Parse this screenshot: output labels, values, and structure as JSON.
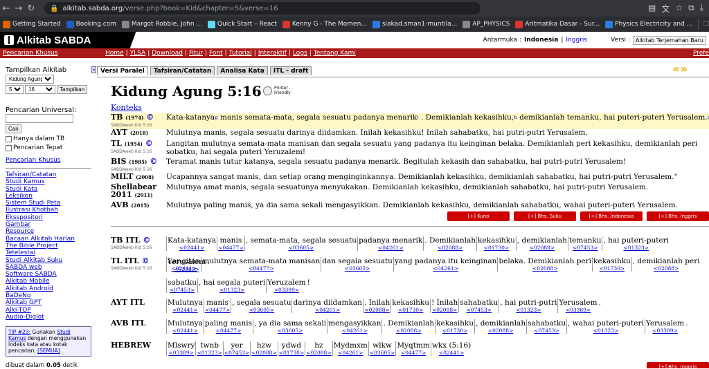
{
  "browser": {
    "url_host": "alkitab.sabda.org",
    "url_path": "/verse.php?book=Kid&chapter=5&verse=16"
  },
  "bookmarks": [
    {
      "label": "Getting Started",
      "color": "#e66000"
    },
    {
      "label": "Booking.com",
      "color": "#1e5fbf"
    },
    {
      "label": "Margot Robbie, John ...",
      "color": "#888"
    },
    {
      "label": "Quick Start – React",
      "color": "#61dafb"
    },
    {
      "label": "Kenny G - The Momen...",
      "color": "#d33"
    },
    {
      "label": "siakad.sman1-muntila...",
      "color": "#2c7be5"
    },
    {
      "label": "AP_PHYSICS",
      "color": "#888"
    },
    {
      "label": "Aritmatika Dasar - Sur...",
      "color": "#d33"
    },
    {
      "label": "Physics Electricity and ...",
      "color": "#2c7be5"
    }
  ],
  "other_bookmarks": "Other Boo",
  "site": {
    "logo": "Alkitab SABDA",
    "antarmuka_label": "Antarmuka :",
    "lang_current": "Indonesia",
    "lang_sep": "|",
    "lang_other": "Inggris",
    "versi_label": "Versi :",
    "versi_value": "Alkitab Terjemahan Baru"
  },
  "nav": {
    "left": "Pencarian Khusus",
    "links": [
      "Home",
      "YLSA",
      "Download",
      "Fitur",
      "Font",
      "Tutorial",
      "Interaktif",
      "Logs",
      "Tentang Kami"
    ],
    "right": "Prefe"
  },
  "sidebar": {
    "tampilkan": "Tampilkan Alkitab",
    "book": "Kidung Agung",
    "chapter": "5",
    "verse": "16",
    "tampilkan_btn": "Tampilkan",
    "pencarian_label": "Pencarian Universal:",
    "cari_btn": "Cari",
    "opt1": "Hanya dalam TB",
    "opt2": "Pencarian Tepat",
    "khusus": "Pencarian Khusus",
    "links": [
      "Tafsiran/Catatan",
      "Studi Kamus",
      "Studi Kata",
      "Leksikon",
      "Sistem Studi Peta",
      "Ilustrasi Khotbah",
      "Eksspositori",
      "Gambar",
      "Resource",
      "Bacaan Alkitab Harian",
      "The Bible Project",
      "Tetelestai",
      "Studi Alkitab Suku",
      "SABDA web",
      "Software SABDA",
      "Alkitab Mobile",
      "Alkitab Android",
      "BaDeNo",
      "Alkitab GPT",
      "Alki-TOP",
      "Audio-Diglot"
    ],
    "tip_prefix": "TIP #23:",
    "tip_text1": " Gunakan ",
    "tip_link": "Studi Kamus",
    "tip_text2": " dengan menggunakan indeks kata atau kotak pencarian. ",
    "tip_semua": "[SEMUA]",
    "footer_pre": "dibuat dalam ",
    "footer_val": "0.05",
    "footer_post": " detik"
  },
  "tabs": [
    "Versi Paralel",
    "Tafsiran/Catatan",
    "Analisa Kata",
    "ITL - draft"
  ],
  "arrows": "«»",
  "title": "Kidung Agung 5:16",
  "printer": [
    "Printer",
    "Friendly"
  ],
  "konteks": "Konteks",
  "verses": [
    {
      "v": "TB",
      "y": "(1974)",
      "copy": "©",
      "sub": "SABDAweb Kid 5:16",
      "t1": "Kata-katanya",
      "s1": "g",
      "t2": " manis semata-mata, segala sesuatu padanya menarik",
      "s2": "i",
      "t3": " . Demikianlah kekasihku,",
      "s3": "h",
      "t4": " demikianlah temanku, hai puteri-puteri Yerusalem.",
      "s4": "i"
    },
    {
      "v": "AYT",
      "y": "(2018)",
      "text": "Mulutnya manis, segala sesuatu darinya diidamkan. Inilah kekasihku! Inilah sahabatku, hai putri-putri Yerusalem."
    },
    {
      "v": "TL",
      "y": "(1954)",
      "copy": "©",
      "sub": "SABDAweb Kid 5:16",
      "text": "Langitan mulutnya semata-mata manisan dan segala sesuatu yang padanya itu keinginan belaka. Demikianlah peri kekasihku, demikianlah peri sobatku, hai segala puteri Yeruzalem!"
    },
    {
      "v": "BIS",
      "y": "(1985)",
      "copy": "©",
      "sub": "SABDAweb Kid 5:16",
      "text": "Teramat manis tutur katanya, segala sesuatu padanya menarik. Begitulah kekasih dan sahabatku, hai putri-putri Yerusalem!"
    },
    {
      "v": "MILT",
      "y": "(2008)",
      "text": "Ucapannya sangat manis, dan setiap orang menginginkannya. Demikianlah kekasihku, demikianlah sahabatku, hai putri-putri Yerusalem.\""
    },
    {
      "v": "Shellabear 2011",
      "y": "(2011)",
      "text": "Mulutnya amat manis, segala sesuatunya menyukakan. Demikianlah kekasihku, demikianlah sahabatku, hai putri-putri Yerusalem."
    },
    {
      "v": "AVB",
      "y": "(2015)",
      "text": "Mulutnya paling manis, ya dia sama sekali mengasyikkan. Demikianlah kekasihku, demikianlah sahabatku, wahai puteri-puteri Yerusalem."
    }
  ],
  "buttons": [
    "[+] Kuno",
    "[+] Bhs. Suku",
    "[+] Bhs. Indonesia",
    "[+] Bhs. Inggris"
  ],
  "itl": [
    {
      "label": "TB ITL",
      "copy": "©",
      "sub": "SABDAweb Kid 5:16",
      "words": [
        [
          "Kata-katanya",
          "<02441>"
        ],
        [
          "manis",
          "<04477>"
        ],
        [
          ", semata-mata, segala sesuatu",
          "<03605>"
        ],
        [
          "padanya menarik",
          "<04261>"
        ],
        [
          ". Demikianlah",
          "<02088>"
        ],
        [
          "kekasihku",
          "<01730>"
        ],
        [
          ", demikianlah",
          "<02088>"
        ],
        [
          "temanku",
          "<07453>"
        ],
        [
          ", hai puteri-puteri",
          "<01323>"
        ],
        [
          "Yerusalem",
          "<03389>"
        ],
        [
          ".",
          ""
        ]
      ]
    },
    {
      "label": "TL ITL",
      "copy": "©",
      "sub": "SABDAweb Kid 5:16",
      "words": [
        [
          "Langitan",
          "<02441>"
        ],
        [
          "mulutnya semata-mata manisan",
          "<04477>"
        ],
        [
          "dan segala sesuatu",
          "<03605>"
        ],
        [
          "yang padanya itu keinginan",
          "<04261>"
        ],
        [
          "belaka. Demikianlah peri",
          "<02088>"
        ],
        [
          "kekasihku",
          "<01730>"
        ],
        [
          ", demikianlah peri",
          "<02088>"
        ],
        [
          "sobatku",
          "<07453>"
        ],
        [
          ", hai segala puteri",
          "<01323>"
        ],
        [
          "Yeruzalem",
          "<03389>"
        ],
        [
          "!",
          ""
        ]
      ]
    },
    {
      "label": "AYT ITL",
      "words": [
        [
          "Mulutnya",
          "<02441>"
        ],
        [
          "manis",
          "<04477>"
        ],
        [
          ", segala sesuatu",
          "<03605>"
        ],
        [
          "darinya diidamkan",
          "<04261>"
        ],
        [
          ". Inilah",
          "<02088>"
        ],
        [
          "kekasihku",
          "<01730>"
        ],
        [
          "! Inilah",
          "<02088>"
        ],
        [
          "sahabatku",
          "<07453>"
        ],
        [
          ", hai putri-putri",
          "<01323>"
        ],
        [
          "Yerusalem",
          "<03389>"
        ],
        [
          ".",
          ""
        ]
      ]
    },
    {
      "label": "AVB ITL",
      "words": [
        [
          "Mulutnya",
          "<02441>"
        ],
        [
          "paling manis",
          "<04477>"
        ],
        [
          ", ya dia sama sekali",
          "<03605>"
        ],
        [
          "mengasyikkan",
          "<04261>"
        ],
        [
          ". Demikianlah",
          "<02088>"
        ],
        [
          "kekasihku",
          "<01730>"
        ],
        [
          ", demikianlah",
          "<02088>"
        ],
        [
          "sahabatku",
          "<07453>"
        ],
        [
          ", wahai puteri-puteri",
          "<01323>"
        ],
        [
          "Yerusalem",
          "<03389>"
        ],
        [
          ".",
          ""
        ]
      ]
    },
    {
      "label": "HEBREW",
      "words": [
        [
          "Mlswry",
          "<03389>"
        ],
        [
          "twnb",
          "<01323>"
        ],
        [
          "yer",
          "<07453>"
        ],
        [
          "hzw",
          "<02088>"
        ],
        [
          "ydwd",
          "<01730>"
        ],
        [
          "hz",
          "<02088>"
        ],
        [
          "Mydmxm",
          "<04261>"
        ],
        [
          "wlkw",
          "<03605>"
        ],
        [
          "Myqtmm",
          "<04477>"
        ],
        [
          "wkx (5:16)",
          "<02441>"
        ]
      ]
    }
  ],
  "buttons2": [
    "[+] Bhs. Inggris"
  ]
}
